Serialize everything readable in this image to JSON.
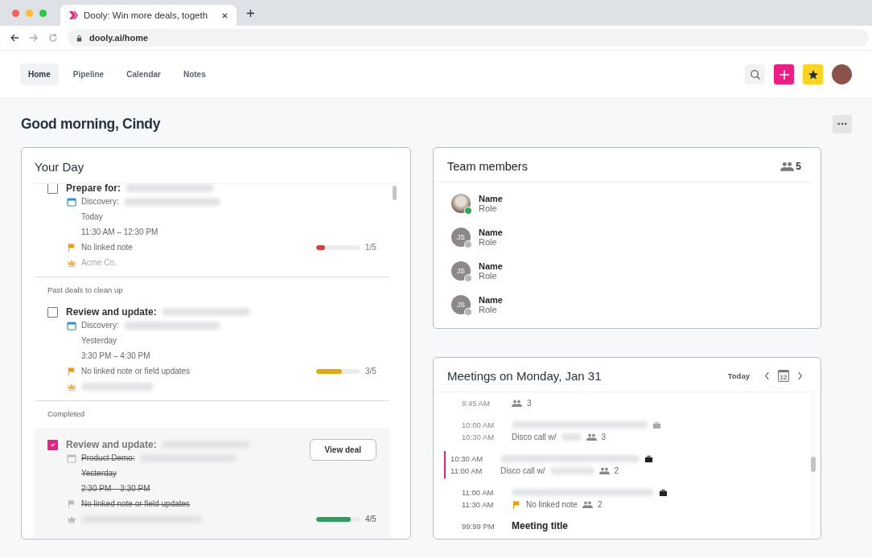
{
  "browser": {
    "tab_title": "Dooly: Win more deals, togeth",
    "url": "dooly.ai/home"
  },
  "nav": {
    "tabs": [
      {
        "label": "Home",
        "selected": true
      },
      {
        "label": "Pipeline",
        "selected": false
      },
      {
        "label": "Calendar",
        "selected": false
      },
      {
        "label": "Notes",
        "selected": false
      }
    ]
  },
  "greeting": "Good morning, Cindy",
  "your_day": {
    "title": "Your Day",
    "sections": [
      {
        "tasks": [
          {
            "checked": false,
            "title": "Prepare for:",
            "meeting": "Discovery:",
            "day": "Today",
            "time": "11:30 AM – 12:30 PM",
            "note": "No linked note",
            "level": 0.2,
            "color": "#e0393e",
            "progress": "1/5",
            "company": "Acme Co."
          }
        ]
      },
      {
        "heading": "Past deals to clean up",
        "tasks": [
          {
            "checked": false,
            "title": "Review and update:",
            "meeting": "Discovery:",
            "day": "Yesterday",
            "time": "3:30 PM – 4:30 PM",
            "note": "No linked note or field updates",
            "level": 0.6,
            "color": "#dcaa10",
            "progress": "3/5"
          }
        ]
      },
      {
        "heading": "Completed",
        "tasks": [
          {
            "checked": true,
            "title": "Review and update:",
            "meeting": "Product Demo:",
            "day": "Yesterday",
            "time": "2:30 PM – 3:30 PM",
            "note": "No linked note or field updates",
            "level": 0.8,
            "color": "#2e9e5e",
            "progress": "4/5",
            "button": "View deal"
          }
        ]
      }
    ]
  },
  "team": {
    "title": "Team members",
    "count": "5",
    "members": [
      {
        "kind": "photo",
        "name": "Name",
        "role": "Role",
        "online": true
      },
      {
        "kind": "initials",
        "initials": "JS",
        "name": "Name",
        "role": "Role",
        "online": false
      },
      {
        "kind": "initials",
        "initials": "JS",
        "name": "Name",
        "role": "Role",
        "online": false
      },
      {
        "kind": "initials",
        "initials": "JS",
        "name": "Name",
        "role": "Role",
        "online": false
      }
    ]
  },
  "meetings": {
    "title": "Meetings on Monday, Jan 31",
    "today": "Today",
    "calendar_day": "12",
    "items": [
      {
        "end": "9:45 AM",
        "attendees": "3",
        "past": true,
        "current": false
      },
      {
        "start": "10:00 AM",
        "end": "10:30 AM",
        "subtitle": "Disco call w/",
        "attendees": "3",
        "past": true,
        "current": false
      },
      {
        "start": "10:30 AM",
        "end": "11:00 AM",
        "subtitle": "Disco call w/",
        "attendees": "2",
        "past": false,
        "current": true
      },
      {
        "start": "11:00 AM",
        "end": "11:30 AM",
        "note": "No linked note",
        "attendees": "2",
        "past": false,
        "current": false
      },
      {
        "start": "99:99 PM",
        "title": "Meeting title",
        "past": false,
        "current": false
      }
    ]
  }
}
